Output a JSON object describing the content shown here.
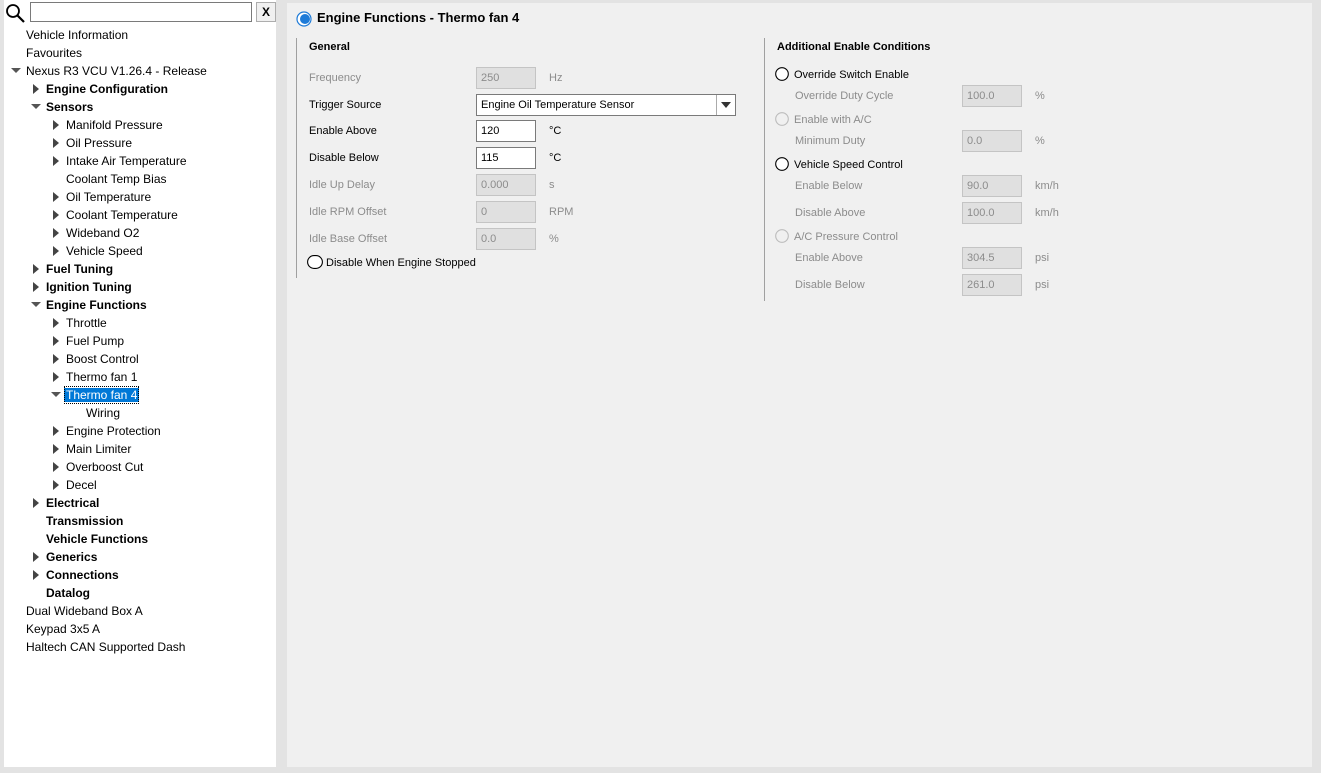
{
  "search": {
    "value": "",
    "clear_label": "X"
  },
  "tree": [
    {
      "label": "Vehicle Information",
      "level": 0,
      "bold": false,
      "expander": "none"
    },
    {
      "label": "Favourites",
      "level": 0,
      "bold": false,
      "expander": "none"
    },
    {
      "label": "Nexus R3 VCU V1.26.4 - Release",
      "level": 0,
      "bold": false,
      "expander": "expanded"
    },
    {
      "label": "Engine Configuration",
      "level": 1,
      "bold": true,
      "expander": "collapsed"
    },
    {
      "label": "Sensors",
      "level": 1,
      "bold": true,
      "expander": "expanded"
    },
    {
      "label": "Manifold Pressure",
      "level": 2,
      "bold": false,
      "expander": "collapsed"
    },
    {
      "label": "Oil Pressure",
      "level": 2,
      "bold": false,
      "expander": "collapsed"
    },
    {
      "label": "Intake Air Temperature",
      "level": 2,
      "bold": false,
      "expander": "collapsed"
    },
    {
      "label": "Coolant Temp Bias",
      "level": 2,
      "bold": false,
      "expander": "none"
    },
    {
      "label": "Oil Temperature",
      "level": 2,
      "bold": false,
      "expander": "collapsed"
    },
    {
      "label": "Coolant Temperature",
      "level": 2,
      "bold": false,
      "expander": "collapsed"
    },
    {
      "label": "Wideband O2",
      "level": 2,
      "bold": false,
      "expander": "collapsed"
    },
    {
      "label": "Vehicle Speed",
      "level": 2,
      "bold": false,
      "expander": "collapsed"
    },
    {
      "label": "Fuel Tuning",
      "level": 1,
      "bold": true,
      "expander": "collapsed"
    },
    {
      "label": "Ignition Tuning",
      "level": 1,
      "bold": true,
      "expander": "collapsed"
    },
    {
      "label": "Engine Functions",
      "level": 1,
      "bold": true,
      "expander": "expanded"
    },
    {
      "label": "Throttle",
      "level": 2,
      "bold": false,
      "expander": "collapsed"
    },
    {
      "label": "Fuel Pump",
      "level": 2,
      "bold": false,
      "expander": "collapsed"
    },
    {
      "label": "Boost Control",
      "level": 2,
      "bold": false,
      "expander": "collapsed"
    },
    {
      "label": "Thermo fan 1",
      "level": 2,
      "bold": false,
      "expander": "collapsed"
    },
    {
      "label": "Thermo fan 4",
      "level": 2,
      "bold": false,
      "expander": "expanded",
      "selected": true
    },
    {
      "label": "Wiring",
      "level": 3,
      "bold": false,
      "expander": "none"
    },
    {
      "label": "Engine Protection",
      "level": 2,
      "bold": false,
      "expander": "collapsed"
    },
    {
      "label": "Main Limiter",
      "level": 2,
      "bold": false,
      "expander": "collapsed"
    },
    {
      "label": "Overboost Cut",
      "level": 2,
      "bold": false,
      "expander": "collapsed"
    },
    {
      "label": "Decel",
      "level": 2,
      "bold": false,
      "expander": "collapsed"
    },
    {
      "label": "Electrical",
      "level": 1,
      "bold": true,
      "expander": "collapsed"
    },
    {
      "label": "Transmission",
      "level": 1,
      "bold": true,
      "expander": "none"
    },
    {
      "label": "Vehicle Functions",
      "level": 1,
      "bold": true,
      "expander": "none"
    },
    {
      "label": "Generics",
      "level": 1,
      "bold": true,
      "expander": "collapsed"
    },
    {
      "label": "Connections",
      "level": 1,
      "bold": true,
      "expander": "collapsed"
    },
    {
      "label": "Datalog",
      "level": 1,
      "bold": true,
      "expander": "none"
    },
    {
      "label": "Dual Wideband Box A",
      "level": 0,
      "bold": false,
      "expander": "none"
    },
    {
      "label": "Keypad 3x5 A",
      "level": 0,
      "bold": false,
      "expander": "none"
    },
    {
      "label": "Haltech CAN Supported Dash",
      "level": 0,
      "bold": false,
      "expander": "none"
    }
  ],
  "page": {
    "title": "Engine Functions - Thermo fan 4",
    "enabled": true,
    "general": {
      "title": "General",
      "frequency": {
        "label": "Frequency",
        "value": "250",
        "unit": "Hz"
      },
      "trigger_source": {
        "label": "Trigger Source",
        "value": "Engine Oil Temperature Sensor"
      },
      "enable_above": {
        "label": "Enable Above",
        "value": "120",
        "unit": "°C"
      },
      "disable_below": {
        "label": "Disable Below",
        "value": "115",
        "unit": "°C"
      },
      "idle_up_delay": {
        "label": "Idle Up Delay",
        "value": "0.000",
        "unit": "s"
      },
      "idle_rpm_offset": {
        "label": "Idle RPM Offset",
        "value": "0",
        "unit": "RPM"
      },
      "idle_base_offset": {
        "label": "Idle Base Offset",
        "value": "0.0",
        "unit": "%"
      },
      "disable_when_stopped": {
        "label": "Disable When Engine Stopped",
        "checked": false
      }
    },
    "additional": {
      "title": "Additional Enable Conditions",
      "override_switch": {
        "label": "Override Switch Enable",
        "checked": false
      },
      "override_duty": {
        "label": "Override Duty Cycle",
        "value": "100.0",
        "unit": "%"
      },
      "enable_ac": {
        "label": "Enable with A/C",
        "checked": false
      },
      "minimum_duty": {
        "label": "Minimum Duty",
        "value": "0.0",
        "unit": "%"
      },
      "vehicle_speed": {
        "label": "Vehicle Speed Control",
        "checked": false
      },
      "vs_enable_below": {
        "label": "Enable Below",
        "value": "90.0",
        "unit": "km/h"
      },
      "vs_disable_above": {
        "label": "Disable Above",
        "value": "100.0",
        "unit": "km/h"
      },
      "ac_pressure": {
        "label": "A/C Pressure Control",
        "checked": false
      },
      "acp_enable_above": {
        "label": "Enable Above",
        "value": "304.5",
        "unit": "psi"
      },
      "acp_disable_below": {
        "label": "Disable Below",
        "value": "261.0",
        "unit": "psi"
      }
    }
  },
  "colors": {
    "selection": "#0078d7",
    "toggle_on": "#1e7bd8",
    "disabled_text": "#8c8c8c"
  }
}
